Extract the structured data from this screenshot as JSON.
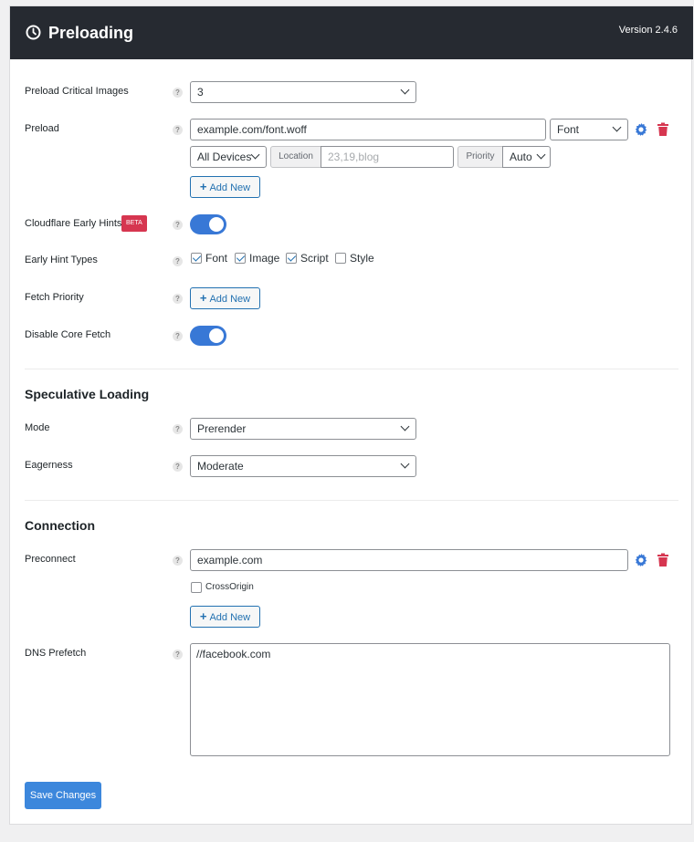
{
  "header": {
    "title": "Preloading",
    "version": "Version 2.4.6"
  },
  "help_glyph": "?",
  "rows": {
    "preload_critical_images": {
      "label": "Preload Critical Images",
      "value": "3"
    },
    "preload": {
      "label": "Preload",
      "url_value": "example.com/font.woff",
      "type_value": "Font",
      "devices_value": "All Devices",
      "location_label": "Location",
      "location_placeholder": "23,19,blog",
      "priority_label": "Priority",
      "priority_value": "Auto",
      "add_new": "Add New"
    },
    "cloudflare_early_hints": {
      "label": "Cloudflare Early Hints",
      "badge": "BETA",
      "enabled": true
    },
    "early_hint_types": {
      "label": "Early Hint Types",
      "options": [
        {
          "label": "Font",
          "checked": true
        },
        {
          "label": "Image",
          "checked": true
        },
        {
          "label": "Script",
          "checked": true
        },
        {
          "label": "Style",
          "checked": false
        }
      ]
    },
    "fetch_priority": {
      "label": "Fetch Priority",
      "add_new": "Add New"
    },
    "disable_core_fetch": {
      "label": "Disable Core Fetch",
      "enabled": true
    }
  },
  "speculative": {
    "title": "Speculative Loading",
    "mode": {
      "label": "Mode",
      "value": "Prerender"
    },
    "eagerness": {
      "label": "Eagerness",
      "value": "Moderate"
    }
  },
  "connection": {
    "title": "Connection",
    "preconnect": {
      "label": "Preconnect",
      "value": "example.com",
      "crossorigin_label": "CrossOrigin",
      "crossorigin_checked": false,
      "add_new": "Add New"
    },
    "dns_prefetch": {
      "label": "DNS Prefetch",
      "value": "//facebook.com"
    }
  },
  "save_label": "Save Changes",
  "colors": {
    "accent": "#3878d6",
    "danger": "#d63650",
    "header_bg": "#262a31"
  },
  "icons": [
    "clock-icon",
    "help-icon",
    "chevron-down-icon",
    "gear-icon",
    "trash-icon",
    "plus-icon",
    "check-icon"
  ]
}
